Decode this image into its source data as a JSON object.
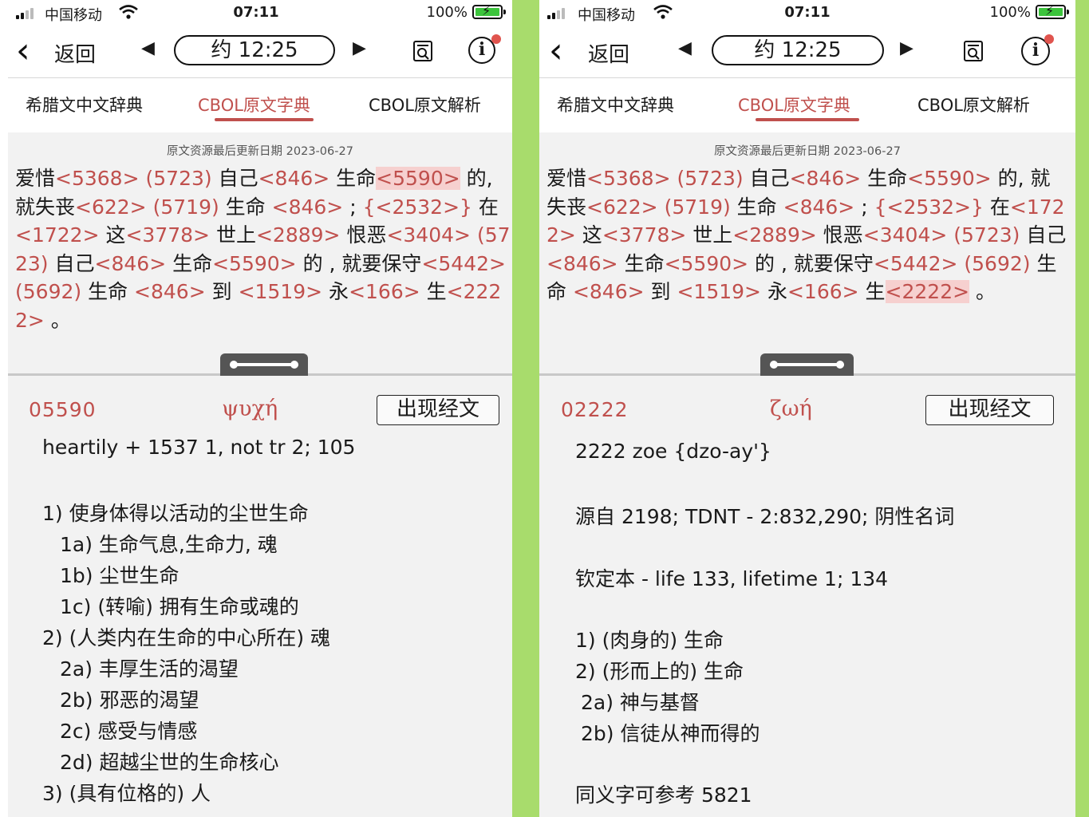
{
  "status": {
    "carrier": "中国移动",
    "time": "07:11",
    "battery": "100%"
  },
  "nav": {
    "back": "返回",
    "reading_time": "约 12:25"
  },
  "tabs": [
    "希腊文中文辞典",
    "CBOL原文字典",
    "CBOL原文解析"
  ],
  "updated": "原文资源最后更新日期 2023-06-27",
  "colors": {
    "accent": "#c0504d",
    "highlight": "#f6d0cf",
    "pane": "#f2f2f2",
    "side_green": "#a8dc6c",
    "badge": "#e0544e"
  },
  "icons": [
    "signal-icon",
    "wifi-icon",
    "battery-icon",
    "back-chevron-icon",
    "prev-arrow-icon",
    "next-arrow-icon",
    "find-in-document-icon",
    "info-icon",
    "drag-handle-icon"
  ],
  "verse_tokens": [
    {
      "t": "爱惜"
    },
    {
      "t": "<5368>",
      "s": "r"
    },
    {
      "t": " "
    },
    {
      "t": "(5723)",
      "s": "r"
    },
    {
      "t": " 自己"
    },
    {
      "t": "<846>",
      "s": "r"
    },
    {
      "t": " 生命"
    },
    {
      "t": "<5590>",
      "s": "r",
      "h": "p1"
    },
    {
      "t": " 的, 就失丧"
    },
    {
      "t": "<622>",
      "s": "r"
    },
    {
      "t": " "
    },
    {
      "t": "(5719)",
      "s": "r"
    },
    {
      "t": " 生命 "
    },
    {
      "t": "<846>",
      "s": "r"
    },
    {
      "t": " ; "
    },
    {
      "t": "{<2532>}",
      "s": "r"
    },
    {
      "t": " 在"
    },
    {
      "t": "<1722>",
      "s": "r"
    },
    {
      "t": " 这"
    },
    {
      "t": "<3778>",
      "s": "r"
    },
    {
      "t": " 世上"
    },
    {
      "t": "<2889>",
      "s": "r"
    },
    {
      "t": " 恨恶"
    },
    {
      "t": "<3404>",
      "s": "r"
    },
    {
      "t": " "
    },
    {
      "t": "(5723)",
      "s": "r"
    },
    {
      "t": " 自己"
    },
    {
      "t": "<846>",
      "s": "r"
    },
    {
      "t": " 生命"
    },
    {
      "t": "<5590>",
      "s": "r"
    },
    {
      "t": " 的 , 就要保守"
    },
    {
      "t": "<5442>",
      "s": "r"
    },
    {
      "t": " "
    },
    {
      "t": "(5692)",
      "s": "r"
    },
    {
      "t": " 生命 "
    },
    {
      "t": "<846>",
      "s": "r"
    },
    {
      "t": " 到 "
    },
    {
      "t": "<1519>",
      "s": "r"
    },
    {
      "t": " 永"
    },
    {
      "t": "<166>",
      "s": "r"
    },
    {
      "t": " 生"
    },
    {
      "t": "<2222>",
      "s": "r",
      "h": "p2"
    },
    {
      "t": " 。"
    }
  ],
  "left": {
    "number": "05590",
    "greek": "ψυχή",
    "button": "出现经文",
    "lines": [
      "heartily + 1537 1, not tr 2; 105",
      "1) 使身体得以活动的尘世生命",
      "1a) 生命气息,生命力, 魂",
      "1b) 尘世生命",
      "1c) (转喻) 拥有生命或魂的",
      "2) (人类内在生命的中心所在) 魂",
      "2a) 丰厚生活的渴望",
      "2b) 邪恶的渴望",
      "2c) 感受与情感",
      "2d) 超越尘世的生命核心",
      "3) (具有位格的) 人"
    ]
  },
  "right": {
    "number": "02222",
    "greek": "ζωή",
    "button": "出现经文",
    "lines": [
      "2222 zoe {dzo-ay'}",
      "源自 2198; TDNT - 2:832,290; 阴性名词",
      "钦定本 - life 133, lifetime 1; 134",
      "1) (肉身的) 生命",
      "2) (形而上的) 生命",
      "2a) 神与基督",
      "2b) 信徒从神而得的",
      "同义字可参考 5821"
    ]
  }
}
